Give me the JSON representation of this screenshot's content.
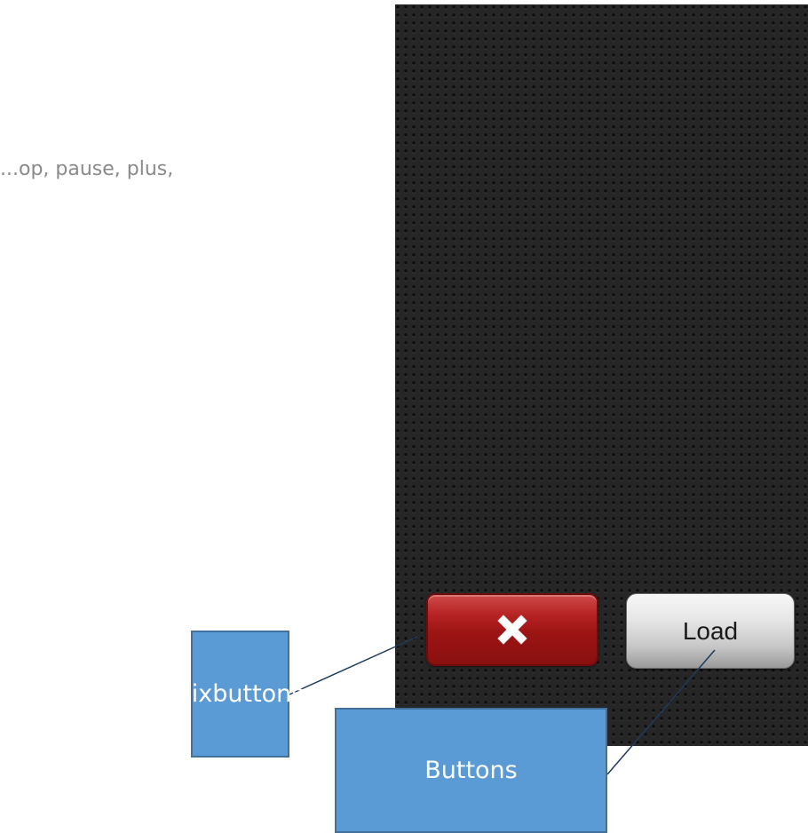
{
  "description_text": "...op, pause, plus,",
  "panel": {
    "background": "#262626"
  },
  "pixbutton": {
    "icon": "close-x-icon",
    "color": "#a51818"
  },
  "load_button": {
    "label": "Load"
  },
  "callouts": {
    "pixbuttons": "pixbuttons",
    "buttons": "Buttons",
    "fill": "#5b9bd5"
  }
}
